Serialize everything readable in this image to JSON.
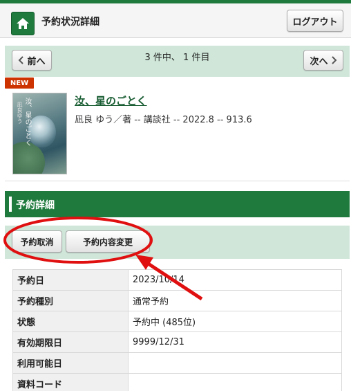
{
  "colors": {
    "brand_green": "#1e7a3d",
    "pager_bg": "#cfe6d9",
    "badge_red": "#cc3300",
    "annotation_red": "#e01010"
  },
  "header": {
    "title": "予約状況詳細",
    "home_icon": "home-icon",
    "logout_label": "ログアウト"
  },
  "pager": {
    "prev_label": "前へ",
    "next_label": "次へ",
    "status_text": "3 件中、 1 件目"
  },
  "book": {
    "badge": "NEW",
    "title": "汝、星のごとく",
    "meta": "凪良 ゆう／著 -- 講談社 -- 2022.8 -- 913.6",
    "cover_title": "汝、星のごとく",
    "cover_author": "凪良ゆう"
  },
  "section": {
    "title": "予約詳細"
  },
  "actions": {
    "cancel_label": "予約取消",
    "change_label": "予約内容変更"
  },
  "details": [
    {
      "label": "予約日",
      "value": "2023/10/14"
    },
    {
      "label": "予約種別",
      "value": "通常予約"
    },
    {
      "label": "状態",
      "value": "予約中 (485位)"
    },
    {
      "label": "有効期限日",
      "value": "9999/12/31"
    },
    {
      "label": "利用可能日",
      "value": ""
    },
    {
      "label": "資料コード",
      "value": ""
    }
  ]
}
